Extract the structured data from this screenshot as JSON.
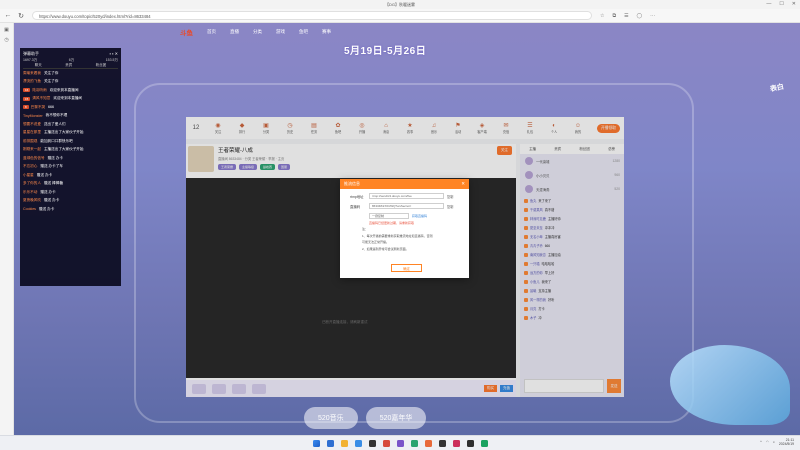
{
  "window": {
    "title": "【DG】秋暖迷雾",
    "url": "https://www.douyu.com/topic/520yd/index.html?rid=8633484",
    "controls": [
      "—",
      "☐",
      "✕"
    ]
  },
  "site": {
    "nav": [
      "首页",
      "直播",
      "分类",
      "游戏",
      "鱼吧",
      "赛事"
    ],
    "logo": "斗鱼",
    "hero_date": "5月19日-5月26日",
    "side_badge": "表白",
    "bottom_banner": [
      "520音乐",
      "520嘉年华"
    ]
  },
  "overlay_chat": {
    "title": "弹幕助手",
    "stats": [
      "1697.3万",
      "6万",
      "153.5万"
    ],
    "tabs": [
      "聊天",
      "贵宾",
      "粉丝团"
    ],
    "lines": [
      {
        "name": "周瑜来看我",
        "msg": "关注了你"
      },
      {
        "name": "漂流的飞鱼",
        "msg": "关注了你"
      },
      {
        "name": "陆羽听雨",
        "msg": "欢迎来到本直播间",
        "badge": "16"
      },
      {
        "name": "清风不知意",
        "msg": "欢迎来到本直播间",
        "badge": "15"
      },
      {
        "name": "巴黎不哭",
        "msg": "666",
        "badge": "8"
      },
      {
        "name": "TinyMonster",
        "msg": "我不想你不理"
      },
      {
        "name": "想要不说爱",
        "msg": "送出了爱人们"
      },
      {
        "name": "星星在那里",
        "msg": "主播送出了大家伙子开始"
      },
      {
        "name": "前排围观",
        "msg": "能加到口口群快乐吧"
      },
      {
        "name": "刚刚来一起",
        "msg": "主播送出了大家伙子开始"
      },
      {
        "name": "蓝绿色的信号",
        "msg": "赠送 办卡"
      },
      {
        "name": "不忘初心",
        "msg": "赠送 办卡了车"
      },
      {
        "name": "小星星",
        "msg": "赠送 办卡"
      },
      {
        "name": "多了你的人",
        "msg": "赠送 棒棒糖"
      },
      {
        "name": "乐乐不动",
        "msg": "赠送 办卡"
      },
      {
        "name": "夏夜晚风吹",
        "msg": "赠送 办卡"
      },
      {
        "name": "Cookies",
        "msg": "赠送 办卡"
      }
    ]
  },
  "site_top": {
    "level": "12",
    "icons": [
      {
        "glyph": "◉",
        "label": "关注"
      },
      {
        "glyph": "◆",
        "label": "排行"
      },
      {
        "glyph": "▣",
        "label": "分类"
      },
      {
        "glyph": "◷",
        "label": "历史"
      },
      {
        "glyph": "▤",
        "label": "任务"
      },
      {
        "glyph": "✿",
        "label": "鱼吧"
      },
      {
        "glyph": "◎",
        "label": "开播"
      },
      {
        "glyph": "⌂",
        "label": "消息"
      },
      {
        "glyph": "★",
        "label": "赛事"
      },
      {
        "glyph": "♫",
        "label": "音乐"
      },
      {
        "glyph": "⚑",
        "label": "活动"
      },
      {
        "glyph": "◈",
        "label": "客户端"
      },
      {
        "glyph": "✉",
        "label": "充值"
      },
      {
        "glyph": "☰",
        "label": "礼包"
      },
      {
        "glyph": "◐",
        "label": "个人"
      },
      {
        "glyph": "☺",
        "label": "我的"
      }
    ],
    "btn": "开播领取"
  },
  "room": {
    "title": "王者荣耀-八成",
    "meta": "直播间 8633484 · 分类 王者荣耀 · 举报 · 主页",
    "tags": [
      "王者荣耀",
      "主播等级",
      "巅峰赛",
      "国服"
    ],
    "follow": "关注",
    "video_hint": "已断开直播连接，请刷新重试",
    "pay": "购买",
    "charge": "充值"
  },
  "rightcol": {
    "head": [
      "主播",
      "贵宾",
      "粉丝团",
      "总榜"
    ],
    "ranks": [
      {
        "name": "一代枭雄",
        "val": "1280"
      },
      {
        "name": "小小贝贝",
        "val": "960"
      },
      {
        "name": "天涯海角",
        "val": "520"
      }
    ],
    "chat": [
      {
        "name": "鱼丸",
        "msg": "来了来了"
      },
      {
        "name": "千载乘风",
        "msg": "真不错"
      },
      {
        "name": "林深时见鹿",
        "msg": "主播好帅"
      },
      {
        "name": "夏至未至",
        "msg": "冲冲冲"
      },
      {
        "name": "无名小辈",
        "msg": "主播真厉害"
      },
      {
        "name": "青青子衿",
        "msg": "666"
      },
      {
        "name": "南风知我意",
        "msg": "主播加油"
      },
      {
        "name": "一只喵",
        "msg": "哈哈哈哈"
      },
      {
        "name": "远方的你",
        "msg": "早上好"
      },
      {
        "name": "小鱼儿",
        "msg": "我来了"
      },
      {
        "name": "晨曦",
        "msg": "支持主播"
      },
      {
        "name": "风一样的我",
        "msg": "好听"
      },
      {
        "name": "月亮",
        "msg": "打卡"
      },
      {
        "name": "木子",
        "msg": "冲"
      }
    ],
    "send": "发送"
  },
  "modal": {
    "title": "推流信息",
    "close": "✕",
    "server_label": "rtmp地址",
    "server_value": "rtmp://sendtc3.douyu.com/live",
    "server_act": "复制",
    "key_label": "直播码",
    "key_value": "8633484rXDJWQ?wsSecret=",
    "key_act": "复制",
    "select_value": "一键复制",
    "link": "获取直播码",
    "warn": "直播码已经更新过期，请重新获取",
    "tips": [
      "注：",
      "1、每次开播前需要重新获取推流地址和直播码，否则",
      "可能无法正常开播。",
      "2、如果遇到异常可尝试刷新页面。"
    ],
    "ok": "确定"
  },
  "taskbar": {
    "icons": [
      "#2f6fd1",
      "#f2b233",
      "#3a8ee6",
      "#333333",
      "#d74b3c",
      "#7a55c9",
      "#2aa36f",
      "#e86a3a",
      "#333333",
      "#cc2f5b",
      "#2f2f2f",
      "#1aa260"
    ],
    "time": "21:11",
    "date": "2024/5/19"
  }
}
